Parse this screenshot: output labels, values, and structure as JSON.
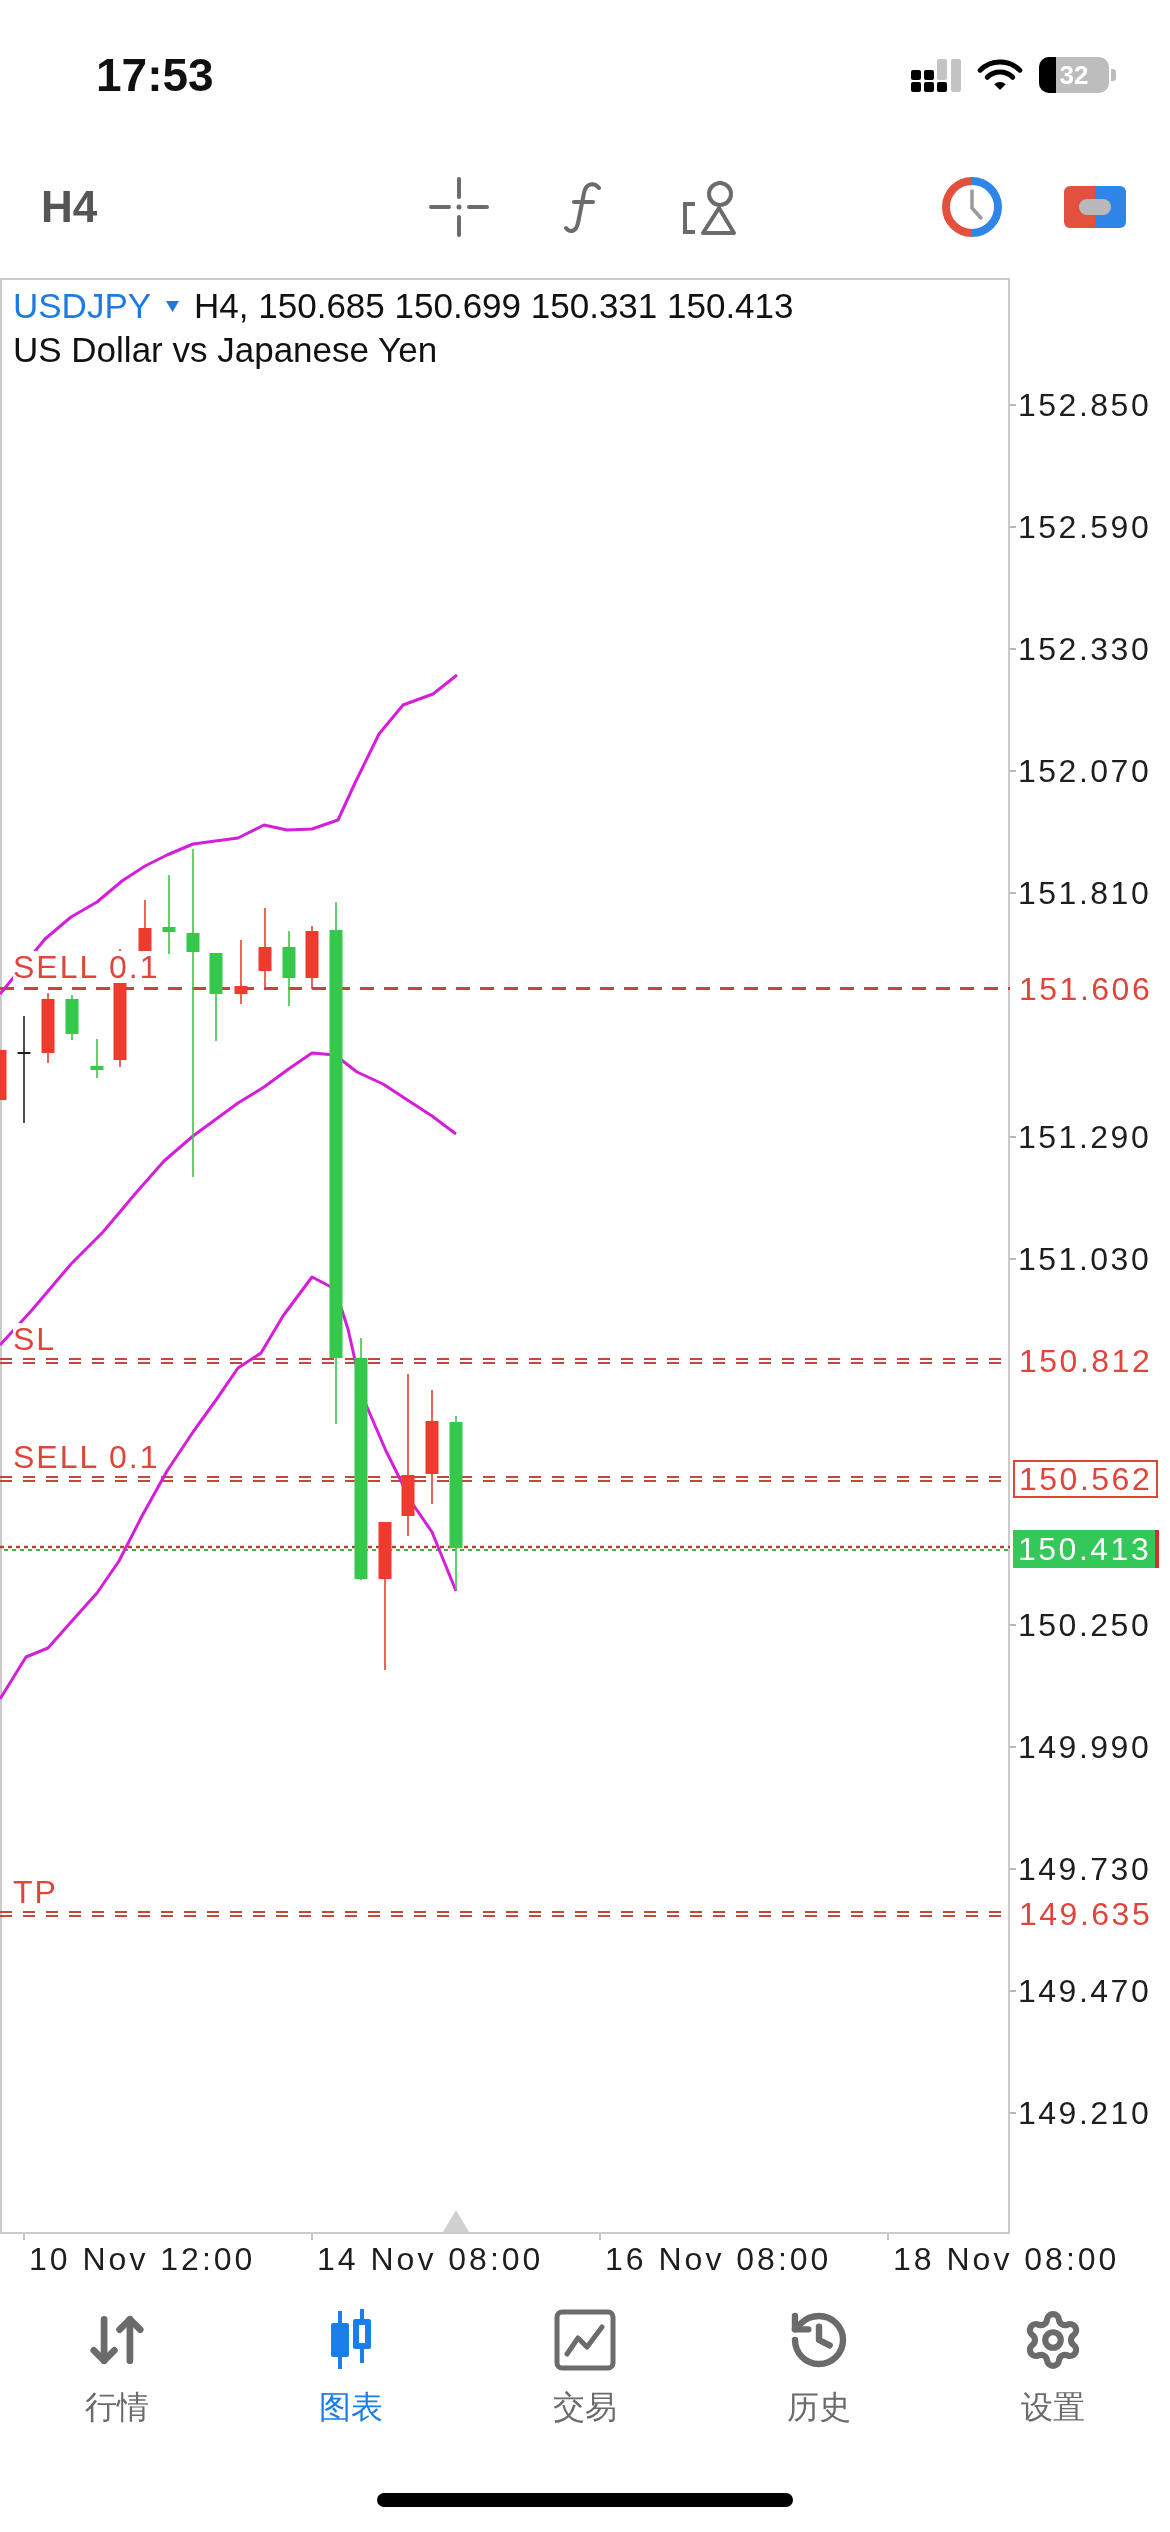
{
  "status_bar": {
    "time": "17:53",
    "battery": "32"
  },
  "toolbar": {
    "timeframe": "H4"
  },
  "chart": {
    "symbol": "USDJPY",
    "ohlc": "H4, 150.685 150.699 150.331 150.413",
    "description": "US Dollar vs Japanese Yen",
    "price_axis": [
      "152.850",
      "152.590",
      "152.330",
      "152.070",
      "151.810",
      "151.290",
      "151.030",
      "150.250",
      "149.990",
      "149.730",
      "149.470",
      "149.210"
    ],
    "orders": [
      {
        "label": "SELL 0.1",
        "price": "151.606",
        "double": false,
        "highlighted": false
      },
      {
        "label": "SL",
        "price": "150.812",
        "double": true,
        "highlighted": false
      },
      {
        "label": "SELL 0.1",
        "price": "150.562",
        "double": true,
        "highlighted": true
      },
      {
        "label": "TP",
        "price": "149.635",
        "double": true,
        "highlighted": false
      }
    ],
    "current_price": "150.413",
    "time_axis": [
      "10 Nov 12:00",
      "14 Nov 08:00",
      "16 Nov 08:00",
      "18 Nov 08:00"
    ]
  },
  "nav": [
    {
      "kind": "quotes",
      "label": "行情",
      "selected": false
    },
    {
      "kind": "chart",
      "label": "图表",
      "selected": true
    },
    {
      "kind": "trade",
      "label": "交易",
      "selected": false
    },
    {
      "kind": "history",
      "label": "历史",
      "selected": false
    },
    {
      "kind": "settings",
      "label": "设置",
      "selected": false
    }
  ]
}
